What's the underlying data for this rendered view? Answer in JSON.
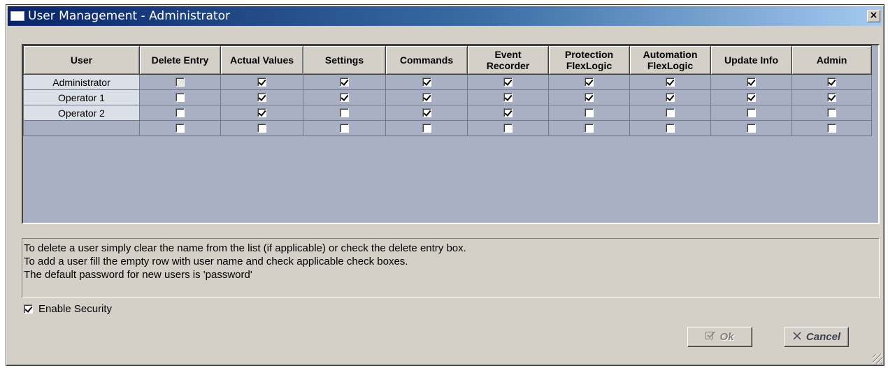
{
  "window": {
    "title": "User Management - Administrator",
    "close_label": "×"
  },
  "grid": {
    "columns": [
      "User",
      "Delete Entry",
      "Actual Values",
      "Settings",
      "Commands",
      "Event\nRecorder",
      "Protection\nFlexLogic",
      "Automation\nFlexLogic",
      "Update Info",
      "Admin"
    ],
    "rows": [
      {
        "user": "Administrator",
        "permissions": [
          false,
          true,
          true,
          true,
          true,
          true,
          true,
          true,
          true
        ],
        "delete_disabled": true
      },
      {
        "user": "Operator 1",
        "permissions": [
          false,
          true,
          true,
          true,
          true,
          true,
          true,
          true,
          true
        ],
        "delete_disabled": false
      },
      {
        "user": "Operator 2",
        "permissions": [
          false,
          true,
          false,
          true,
          true,
          false,
          false,
          false,
          false
        ],
        "delete_disabled": false
      },
      {
        "user": "",
        "permissions": [
          false,
          false,
          false,
          false,
          false,
          false,
          false,
          false,
          false
        ],
        "delete_disabled": false
      }
    ]
  },
  "info": {
    "lines": [
      "To delete a user simply clear the name from the list (if applicable) or check the delete entry box.",
      "To add a user fill the empty row with user name and check applicable check boxes.",
      "The default password for new users is 'password'"
    ]
  },
  "security": {
    "label": "Enable Security",
    "checked": true
  },
  "buttons": {
    "ok_label": "Ok",
    "ok_icon": "checkbox-icon",
    "cancel_label": "Cancel",
    "cancel_icon": "x-icon"
  },
  "colors": {
    "title_gradient_start": "#0a246a",
    "grid_background": "#a9b0c4",
    "dialog_background": "#d4d0c8"
  }
}
